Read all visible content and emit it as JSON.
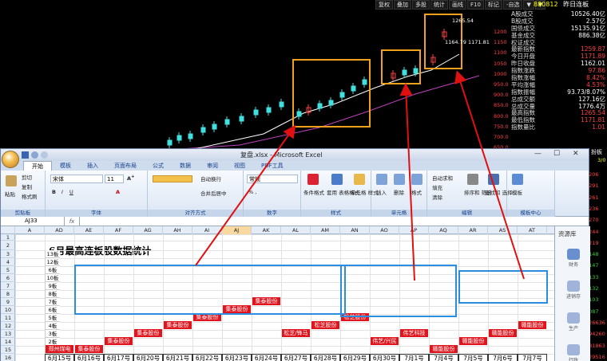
{
  "terminal": {
    "toolbar": [
      "复权",
      "叠加",
      "多股",
      "统计",
      "画线",
      "F10",
      "标记",
      "-自选",
      "▼",
      "▼"
    ],
    "code": "880812",
    "name": "昨日连板",
    "stats": [
      {
        "label": "A股成交",
        "value": "10526.40亿",
        "red": false
      },
      {
        "label": "B股成交",
        "value": "2.57亿",
        "red": false
      },
      {
        "label": "国债成交",
        "value": "15135.91亿",
        "red": false
      },
      {
        "label": "基金成交",
        "value": "886.38亿",
        "red": false
      },
      {
        "label": "权证成交",
        "value": "",
        "red": false
      },
      {
        "label": "最新指数",
        "value": "1259.87",
        "red": true
      },
      {
        "label": "今日开盘",
        "value": "1171.89",
        "red": true
      },
      {
        "label": "昨日收盘",
        "value": "1162.01",
        "red": false
      },
      {
        "label": "指数涨跌",
        "value": "97.86",
        "red": true
      },
      {
        "label": "指数涨幅",
        "value": "8.42%",
        "red": true
      },
      {
        "label": "平均涨幅",
        "value": "4.53%",
        "red": true
      },
      {
        "label": "指数振幅",
        "value": "93.73/8.07%",
        "red": false
      },
      {
        "label": "总成交额",
        "value": "127.16亿",
        "red": false
      },
      {
        "label": "总成交量",
        "value": "1776.4万",
        "red": false
      },
      {
        "label": "最高指数",
        "value": "1265.54",
        "red": true
      },
      {
        "label": "最低指数",
        "value": "1171.81",
        "red": true
      },
      {
        "label": "指数量比",
        "value": "1.01",
        "red": true
      }
    ],
    "price_axis": [
      "1200",
      "1150",
      "1100",
      "1050",
      "1000",
      "950.0",
      "900.0",
      "850.0",
      "800.0",
      "750.0",
      "700.0",
      "650.0"
    ],
    "annotations": [
      "1265.54",
      "1164.79",
      "1171.81"
    ],
    "side_label": "扮板",
    "side_ratio": "3/0",
    "volume_col": [
      "1206",
      "1291",
      "1261",
      "1236",
      "1270",
      "1244",
      "1219",
      "1148",
      "1147",
      "1133",
      "1132",
      "1103",
      "1087",
      "226636",
      "194260",
      "181863",
      "129516"
    ]
  },
  "excel": {
    "title": "复盘.xlsx - Microsoft Excel",
    "tabs": [
      "开始",
      "模板",
      "插入",
      "页面布局",
      "公式",
      "数据",
      "审阅",
      "视图",
      "PDF工具"
    ],
    "ribbon": {
      "paste": "粘贴",
      "cut": "剪切",
      "copy": "复制",
      "format_painter": "格式刷",
      "font": "宋体",
      "font_size": "11",
      "wrap": "自动换行",
      "merge": "合并后居中",
      "number_format": "常规",
      "cond_format": "条件格式",
      "table_format": "套用\n表格格式",
      "cell_style": "单元格\n样式",
      "insert": "插入",
      "delete": "删除",
      "format": "格式",
      "autosum": "自动求和",
      "fill": "填充",
      "clear": "清除",
      "sort": "排序和\n筛选",
      "find": "查找和\n选择",
      "template": "模板",
      "groups": [
        "剪贴板",
        "字体",
        "对齐方式",
        "数字",
        "样式",
        "单元格",
        "编辑",
        "模板中心"
      ]
    },
    "name_box": "AJ33",
    "fx": "fx",
    "columns": [
      "A",
      "AD",
      "AE",
      "AF",
      "AG",
      "AH",
      "AI",
      "AJ",
      "AK",
      "AL",
      "AM",
      "AN",
      "AO",
      "AP",
      "AQ",
      "AR",
      "AS",
      "AT"
    ],
    "selected_column": "AJ",
    "rows": [
      "1",
      "2",
      "3",
      "4",
      "5",
      "6",
      "7",
      "8",
      "9",
      "10",
      "11",
      "12",
      "13",
      "14",
      "15",
      "16"
    ],
    "sheet_title": "6月最高连板股数据统计",
    "board_labels": [
      "13板",
      "12板",
      "6板",
      "10板",
      "9板",
      "8板",
      "7板",
      "6板",
      "5板",
      "4板",
      "3板",
      "2板",
      "1板"
    ],
    "dates": [
      "6月15号",
      "6月16号",
      "6月17号",
      "6月20号",
      "6月21号",
      "6月22号",
      "6月23号",
      "6月24号",
      "6月27号",
      "6月28号",
      "6月29号",
      "6月30号",
      "7月1号",
      "7月4号",
      "7月5号",
      "7月6号",
      "7月7号"
    ],
    "stocks": [
      {
        "name": "郑州煤电",
        "col": 0,
        "row": 5
      },
      {
        "name": "集泰股份",
        "col": 1,
        "row": 5
      },
      {
        "name": "集泰股份",
        "col": 2,
        "row": 4
      },
      {
        "name": "集泰股份",
        "col": 3,
        "row": 3
      },
      {
        "name": "集泰股份",
        "col": 4,
        "row": 2
      },
      {
        "name": "集泰股份",
        "col": 5,
        "row": 1
      },
      {
        "name": "集泰股份",
        "col": 6,
        "row": 0
      },
      {
        "name": "集泰股份",
        "col": 7,
        "row": -1
      },
      {
        "name": "松芝/锋马",
        "col": 8,
        "row": 3
      },
      {
        "name": "松芝股份",
        "col": 9,
        "row": 2
      },
      {
        "name": "松芝股份",
        "col": 10,
        "row": 1
      },
      {
        "name": "伟艺/兴民",
        "col": 11,
        "row": 4
      },
      {
        "name": "伟艺科技",
        "col": 12,
        "row": 3
      },
      {
        "name": "赣能股份",
        "col": 13,
        "row": 5
      },
      {
        "name": "赣能股份",
        "col": 14,
        "row": 4
      },
      {
        "name": "赣能股份",
        "col": 15,
        "row": 3
      },
      {
        "name": "赣能股份",
        "col": 16,
        "row": 2
      }
    ],
    "task_pane": {
      "title": "资源库",
      "items": [
        "财务",
        "进销存",
        "生产",
        "行政"
      ]
    }
  }
}
